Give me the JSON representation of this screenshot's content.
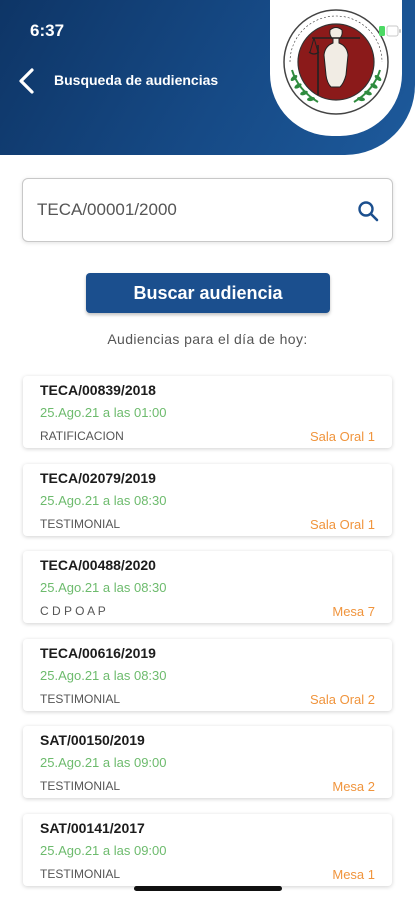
{
  "status_bar": {
    "time": "6:37"
  },
  "header": {
    "title": "Busqueda de audiencias"
  },
  "logo": {
    "seal_text": "TRIBUNAL ESTATAL DE CONCILIACIÓN Y ARBITRAJE"
  },
  "search": {
    "value": "TECA/00001/2000"
  },
  "search_button": {
    "label": "Buscar audiencia"
  },
  "section_label": "Audiencias para el día de hoy:",
  "hearings": [
    {
      "case": "TECA/00839/2018",
      "datetime": "25.Ago.21 a las 01:00",
      "type": "RATIFICACION",
      "room": "Sala Oral 1"
    },
    {
      "case": "TECA/02079/2019",
      "datetime": "25.Ago.21 a las 08:30",
      "type": "TESTIMONIAL",
      "room": "Sala Oral 1"
    },
    {
      "case": "TECA/00488/2020",
      "datetime": "25.Ago.21 a las 08:30",
      "type": "C D P O A P",
      "room": "Mesa 7"
    },
    {
      "case": "TECA/00616/2019",
      "datetime": "25.Ago.21 a las 08:30",
      "type": "TESTIMONIAL",
      "room": "Sala Oral 2"
    },
    {
      "case": "SAT/00150/2019",
      "datetime": "25.Ago.21 a las 09:00",
      "type": "TESTIMONIAL",
      "room": "Mesa 2"
    },
    {
      "case": "SAT/00141/2017",
      "datetime": "25.Ago.21 a las 09:00",
      "type": "TESTIMONIAL",
      "room": "Mesa 1"
    }
  ],
  "colors": {
    "header": "#164a86",
    "button": "#1b4f8e",
    "date_green": "#6dbb6d",
    "room_orange": "#f0943c",
    "seal_red": "#8b1a1a"
  },
  "icons": {
    "back": "chevron-left-icon",
    "search": "search-icon",
    "logo": "justice-seal-logo",
    "battery": "battery-icon"
  }
}
